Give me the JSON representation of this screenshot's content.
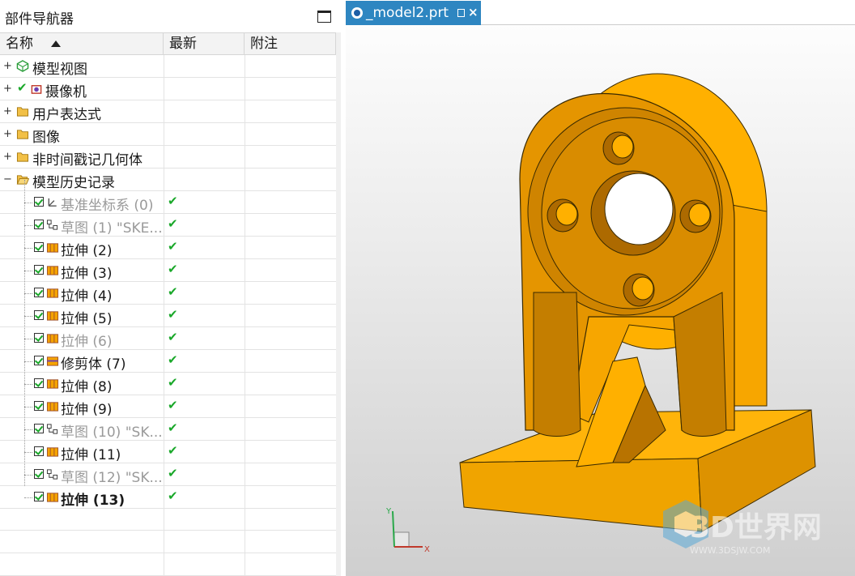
{
  "navigator": {
    "title": "部件导航器",
    "columns": {
      "name": "名称",
      "latest": "最新",
      "note": "附注"
    }
  },
  "tree": {
    "top": [
      {
        "label": "模型视图"
      },
      {
        "label": "摄像机"
      },
      {
        "label": "用户表达式"
      },
      {
        "label": "图像"
      },
      {
        "label": "非时间戳记几何体"
      },
      {
        "label": "模型历史记录"
      }
    ],
    "history": [
      {
        "label": "基准坐标系 (0)",
        "latest": "✔"
      },
      {
        "label": "草图 (1) \"SKE...",
        "latest": "✔"
      },
      {
        "label": "拉伸 (2)",
        "latest": "✔"
      },
      {
        "label": "拉伸 (3)",
        "latest": "✔"
      },
      {
        "label": "拉伸 (4)",
        "latest": "✔"
      },
      {
        "label": "拉伸 (5)",
        "latest": "✔"
      },
      {
        "label": "拉伸 (6)",
        "latest": "✔"
      },
      {
        "label": "修剪体 (7)",
        "latest": "✔"
      },
      {
        "label": "拉伸 (8)",
        "latest": "✔"
      },
      {
        "label": "拉伸 (9)",
        "latest": "✔"
      },
      {
        "label": "草图 (10) \"SK...",
        "latest": "✔"
      },
      {
        "label": "拉伸 (11)",
        "latest": "✔"
      },
      {
        "label": "草图 (12) \"SK...",
        "latest": "✔"
      },
      {
        "label": "拉伸 (13)",
        "latest": "✔"
      }
    ]
  },
  "tab": {
    "label": "_model2.prt",
    "close": "×"
  },
  "triad": {
    "x": "X",
    "y": "Y"
  },
  "watermark": {
    "brand": "3D世界网",
    "url": "WWW.3DSJW.COM"
  },
  "colors": {
    "accent": "#2e86c1",
    "part": "#f5a300",
    "check": "#1aa82a"
  }
}
